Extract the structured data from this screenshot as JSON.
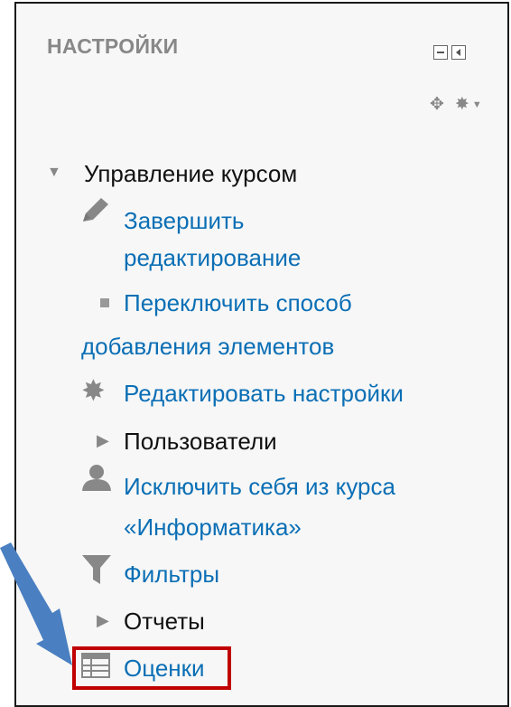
{
  "block": {
    "title": "НАСТРОЙКИ",
    "controls": [
      "dock-minimize",
      "dock-left"
    ],
    "tools": [
      "move-icon",
      "gear-icon"
    ]
  },
  "menu": {
    "course_admin": "Управление курсом",
    "finish_editing_1": "Завершить",
    "finish_editing_2": "редактирование",
    "switch_add_1": "Переключить способ",
    "switch_add_2": "добавления элементов",
    "edit_settings": "Редактировать настройки",
    "users": "Пользователи",
    "unenrol_1": "Исключить себя из курса",
    "unenrol_2": "«Информатика»",
    "filters": "Фильтры",
    "reports": "Отчеты",
    "grades": "Оценки"
  },
  "colors": {
    "link": "#0b6fb5",
    "highlight": "#c00000",
    "arrow": "#4a7fc1"
  }
}
